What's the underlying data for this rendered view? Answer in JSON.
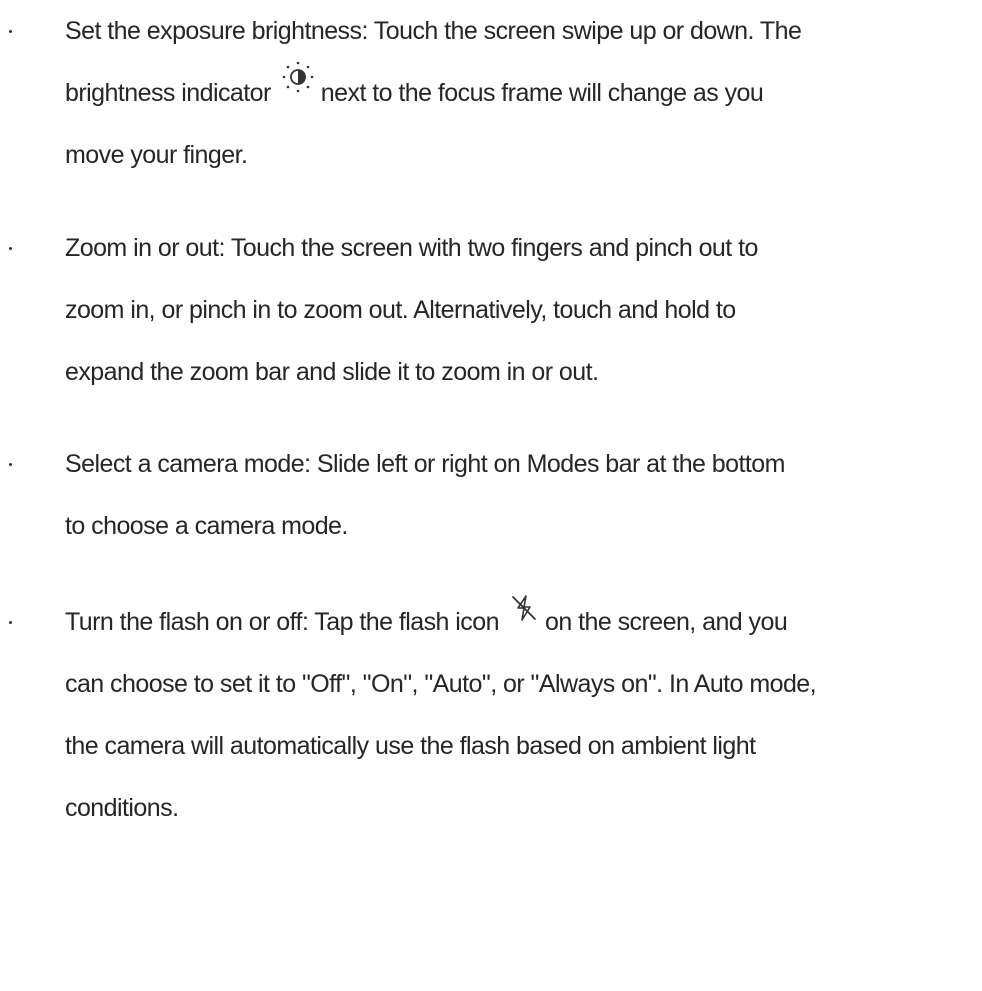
{
  "bullets": [
    {
      "lines": [
        "Set the exposure brightness: Touch the screen swipe up or down. The",
        "brightness indicator",
        "next to the focus frame will change as you",
        "move your finger."
      ],
      "icon": "brightness-icon"
    },
    {
      "lines": [
        "Zoom in or out: Touch the screen with two fingers and pinch out to",
        "zoom in, or pinch in to zoom out. Alternatively, touch and hold to",
        "expand the zoom bar and slide it to zoom in or out."
      ]
    },
    {
      "lines": [
        "Select a camera mode: Slide left or right on Modes bar at the bottom",
        "to choose a camera mode."
      ]
    },
    {
      "lines": [
        "Turn the flash on or off: Tap the flash icon",
        "on the screen, and you",
        "can choose to set it to \"Off\", \"On\", \"Auto\", or \"Always on\". In Auto mode,",
        "the camera will automatically use the flash based on ambient light",
        "conditions."
      ],
      "icon": "flash-off-icon"
    }
  ],
  "colors": {
    "text": "#262626",
    "bullet": "#333333"
  }
}
